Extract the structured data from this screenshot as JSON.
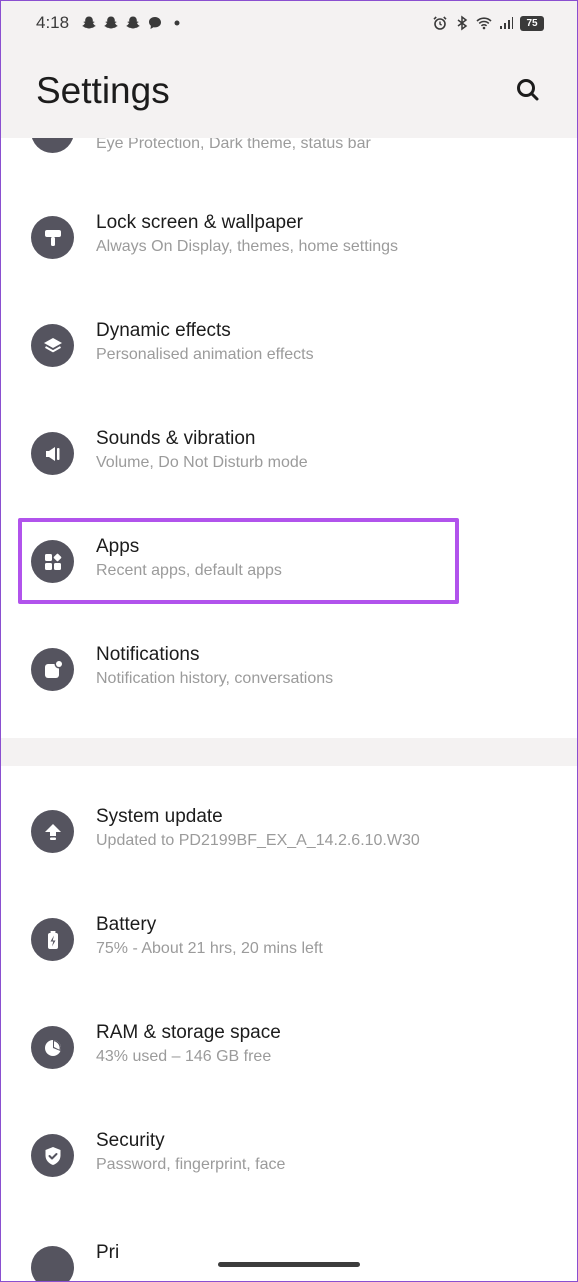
{
  "status_bar": {
    "time": "4:18",
    "battery": "75",
    "left_icons": [
      "snapchat-icon",
      "snapchat-icon",
      "snapchat-icon",
      "chat-bubble-icon",
      "dot-icon"
    ],
    "right_icons": [
      "alarm-icon",
      "bluetooth-icon",
      "wifi-icon",
      "signal-icon",
      "battery-icon"
    ]
  },
  "header": {
    "title": "Settings",
    "search_icon": "search-icon"
  },
  "partial_top_item": {
    "subtitle": "Eye Protection, Dark theme, status bar"
  },
  "group1": [
    {
      "id": "lock-screen",
      "title": "Lock screen & wallpaper",
      "subtitle": "Always On Display, themes, home settings",
      "icon": "brush-icon"
    },
    {
      "id": "dynamic-effects",
      "title": "Dynamic effects",
      "subtitle": "Personalised animation effects",
      "icon": "layers-icon"
    },
    {
      "id": "sounds",
      "title": "Sounds & vibration",
      "subtitle": "Volume, Do Not Disturb mode",
      "icon": "speaker-icon"
    },
    {
      "id": "apps",
      "title": "Apps",
      "subtitle": "Recent apps, default apps",
      "icon": "apps-grid-icon"
    },
    {
      "id": "notifications",
      "title": "Notifications",
      "subtitle": "Notification history, conversations",
      "icon": "notification-badge-icon"
    }
  ],
  "group2": [
    {
      "id": "system-update",
      "title": "System update",
      "subtitle": "Updated to PD2199BF_EX_A_14.2.6.10.W30",
      "icon": "upload-arrow-icon"
    },
    {
      "id": "battery",
      "title": "Battery",
      "subtitle": "75% - About 21 hrs, 20 mins left",
      "icon": "battery-bolt-icon"
    },
    {
      "id": "ram-storage",
      "title": "RAM & storage space",
      "subtitle": "43% used – 146 GB free",
      "icon": "pie-chart-icon"
    },
    {
      "id": "security",
      "title": "Security",
      "subtitle": "Password, fingerprint, face",
      "icon": "shield-check-icon"
    }
  ],
  "partial_bottom_item": {
    "title": "Pri"
  },
  "colors": {
    "highlight": "#b153ec",
    "icon_bg": "#55545f",
    "band_bg": "#f4f2f2"
  }
}
